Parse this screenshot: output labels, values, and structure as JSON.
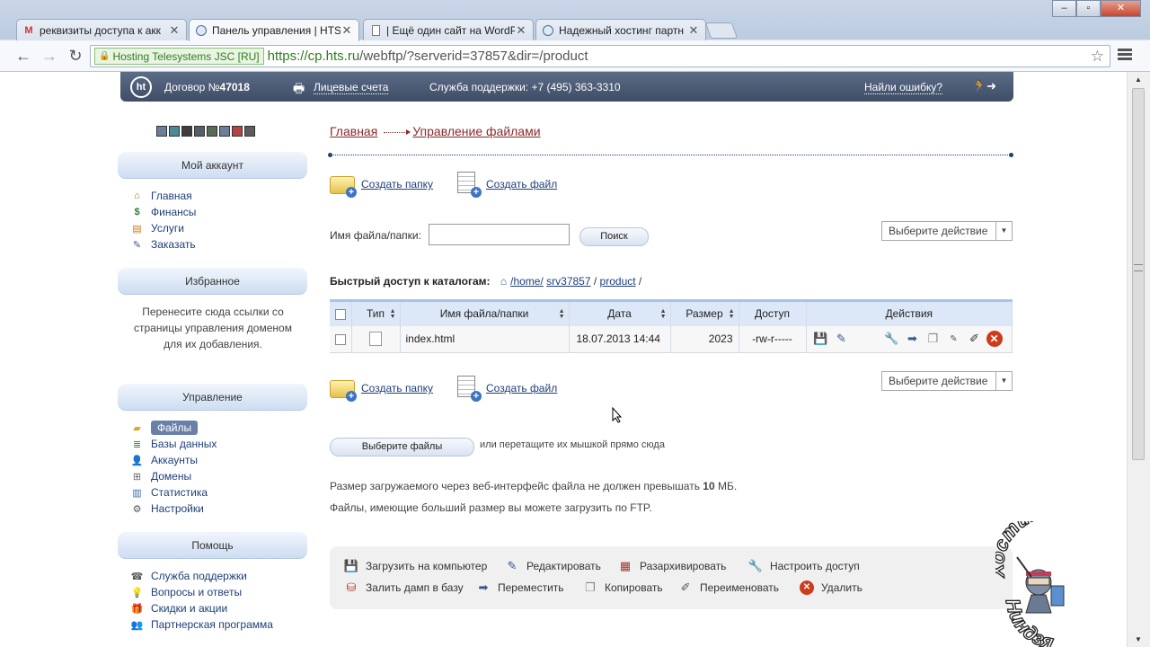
{
  "browser": {
    "tabs": [
      {
        "title": "реквизиты доступа к акк",
        "icon": "gmail-icon"
      },
      {
        "title": "Панель управления | HTS",
        "icon": "hts-icon"
      },
      {
        "title": "| Ещё один сайт на WordP",
        "icon": "document-icon"
      },
      {
        "title": "Надежный хостинг партн",
        "icon": "hts-icon"
      }
    ],
    "ev_badge": "Hosting Telesystems JSC [RU]",
    "url_scheme_host": "https://cp.hts.ru",
    "url_path": "/webftp/?serverid=37857&dir=/product"
  },
  "header": {
    "logo": "ht",
    "contract_label": "Договор №",
    "contract_number": "47018",
    "accounts_link": "Лицевые счета",
    "support": "Служба поддержки: +7 (495) 363-3310",
    "found_error": "Найли ошибку?",
    "logout_icon": "exit-icon",
    "swatch_colors": [
      "#6c7f96",
      "#4a8a97",
      "#3e3e3e",
      "#555d68",
      "#5a6a58",
      "#6b7f9a",
      "#b54343",
      "#5c5c5c"
    ]
  },
  "sidebar": {
    "account": {
      "title": "Мой аккаунт",
      "items": [
        {
          "label": "Главная",
          "icon": "home-icon"
        },
        {
          "label": "Финансы",
          "icon": "dollar-icon"
        },
        {
          "label": "Услуги",
          "icon": "clipboard-icon"
        },
        {
          "label": "Заказать",
          "icon": "order-icon"
        }
      ]
    },
    "favorites": {
      "title": "Избранное",
      "text": "Перенесите сюда ссылки со страницы управления доменом для их добавления."
    },
    "management": {
      "title": "Управление",
      "items": [
        {
          "label": "Файлы",
          "icon": "folder-icon"
        },
        {
          "label": "Базы данных",
          "icon": "database-icon"
        },
        {
          "label": "Аккаунты",
          "icon": "users-icon"
        },
        {
          "label": "Домены",
          "icon": "domains-icon"
        },
        {
          "label": "Статистика",
          "icon": "chart-icon"
        },
        {
          "label": "Настройки",
          "icon": "gear-icon"
        }
      ]
    },
    "help": {
      "title": "Помощь",
      "items": [
        {
          "label": "Служба поддержки",
          "icon": "phone-icon"
        },
        {
          "label": "Вопросы и ответы",
          "icon": "lightbulb-icon"
        },
        {
          "label": "Скидки и акции",
          "icon": "gift-icon"
        },
        {
          "label": "Партнерская программа",
          "icon": "partners-icon"
        }
      ]
    }
  },
  "main": {
    "breadcrumb": {
      "home": "Главная",
      "current": "Управление файлами"
    },
    "create_folder": "Создать папку",
    "create_file": "Создать файл",
    "search_label": "Имя файла/папки:",
    "search_value": "",
    "search_button": "Поиск",
    "action_select": "Выберите действие",
    "quick_access_label": "Быстрый доступ к каталогам:",
    "path": {
      "home": "/home/",
      "server": "srv37857",
      "sep": " / ",
      "dir": "product",
      "end": " /"
    },
    "table": {
      "headers": [
        "Тип",
        "Имя файла/папки",
        "Дата",
        "Размер",
        "Доступ",
        "Действия"
      ],
      "rows": [
        {
          "name": "index.html",
          "date": "18.07.2013 14:44",
          "size": "2023",
          "access": "-rw-r-----"
        }
      ]
    },
    "choose_files": "Выберите файлы",
    "drag_text": "или перетащите их мышкой прямо сюда",
    "info_line1_prefix": "Размер загружаемого через веб-интерфейс файла не должен превышать ",
    "info_line1_value": "10",
    "info_line1_suffix": " МБ.",
    "info_line2": "Файлы, имеющие больший размер вы можете загрузить по FTP.",
    "legend": [
      {
        "label": "Загрузить на компьютер",
        "icon": "download-icon"
      },
      {
        "label": "Редактировать",
        "icon": "pencil-icon"
      },
      {
        "label": "Разархивировать",
        "icon": "archive-icon"
      },
      {
        "label": "Настроить доступ",
        "icon": "permissions-icon"
      },
      {
        "label": "Залить дамп в базу",
        "icon": "dump-icon"
      },
      {
        "label": "Переместить",
        "icon": "move-icon"
      },
      {
        "label": "Копировать",
        "icon": "copy-icon"
      },
      {
        "label": "Переименовать",
        "icon": "rename-icon"
      },
      {
        "label": "Удалить",
        "icon": "delete-icon"
      }
    ]
  },
  "watermark": {
    "top": "Хостинг-",
    "bottom": "Ниндзя"
  }
}
